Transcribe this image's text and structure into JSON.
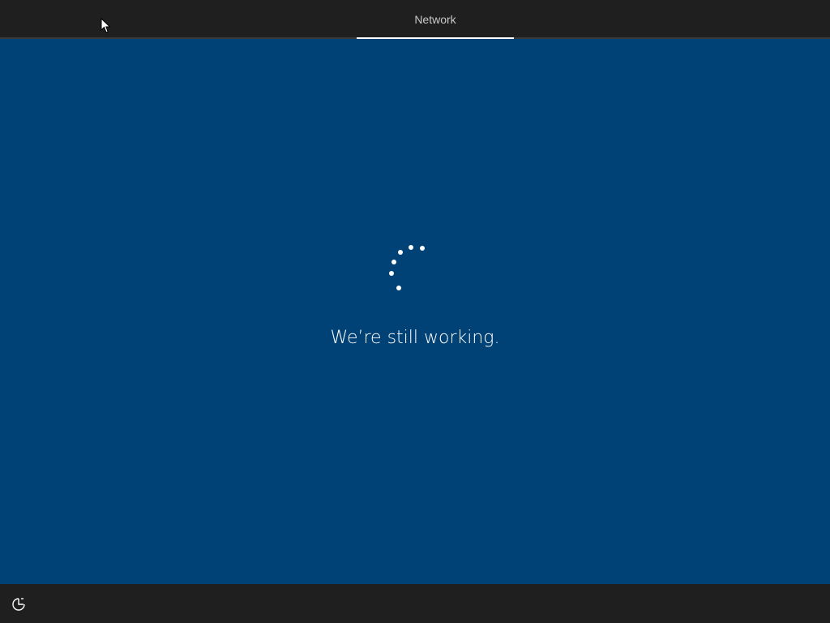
{
  "header": {
    "tabs": [
      {
        "label": "Network",
        "active": true
      }
    ]
  },
  "main": {
    "status_text": "We’re still working.",
    "spinner_icon": "loading-dots-spinner"
  },
  "footer": {
    "ease_of_access_icon": "ease-of-access-icon"
  },
  "colors": {
    "background": "#004275",
    "bars": "#1f1f1f",
    "text": "#ffffff",
    "tab_text": "#c9c9c9"
  }
}
